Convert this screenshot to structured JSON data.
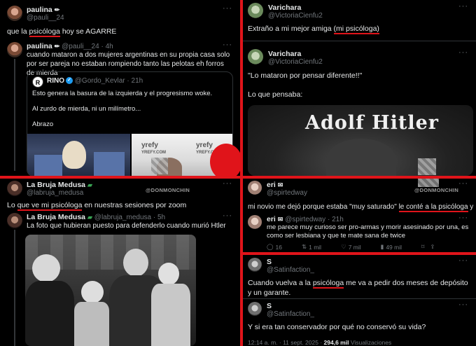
{
  "panel1": {
    "post": {
      "name": "paulina",
      "name_icon": "pencil-icon",
      "handle": "@pauli__24",
      "text_prefix": "que la ",
      "text_highlight": "psicóloga",
      "text_suffix": " hoy se AGARRE"
    },
    "reply": {
      "name": "paulina",
      "meta": "@pauli__24 · 4h",
      "text": "cuando mataron a dos mujeres argentinas en su propia casa solo por ser pareja no estaban rompiendo tanto las pelotas eh forros de mierda"
    },
    "quote": {
      "name": "RINO",
      "avatar_text": "R",
      "meta": "@Gordo_Kevlar · 21h",
      "line1": "Esto genera la basura de la izquierda y el progresismo woke.",
      "line2": "Al zurdo de mierda, ni un milímetro...",
      "line3": "Abrazo",
      "photo_text_1": "yrefy",
      "photo_text_2": "YREFY.COM",
      "photo_text_3": "yrefy",
      "photo_text_4": "YREFY.COM"
    }
  },
  "panel2": {
    "post1": {
      "name": "Varichara",
      "handle": "@VictoriaCienfu2",
      "text_prefix": "Extraño a mi mejor amiga ",
      "text_highlight": "(mi psicóloga)"
    },
    "post2": {
      "name": "Varichara",
      "handle": "@VictoriaCienfu2",
      "line1": "\"Lo mataron por pensar diferente!!\"",
      "line2": "Lo que pensaba:",
      "image_title": "Adolf Hitler"
    }
  },
  "panel3": {
    "watermark": "@DONMONCHIN",
    "post": {
      "name": "La Bruja Medusa",
      "flag_icon": "flag-icon",
      "handle": "@labruja_medusa",
      "text_prefix": "Lo ",
      "text_highlight": "que ve mi psicóloga",
      "text_suffix": " en nuestras sesiones por zoom"
    },
    "reply": {
      "name": "La Bruja Medusa",
      "meta": "@labruja_medusa · 5h",
      "text": "La foto que hubieran puesto para defenderlo cuando murió Htler"
    }
  },
  "panel4": {
    "watermark": "@DONMONCHIN",
    "post": {
      "name": "eri",
      "handle": "@spirtedway",
      "text_prefix": "mi novio me dejó porque estaba \"muy saturado\" ",
      "text_highlight": "le conté a la psicóloga",
      "text_suffix": " y"
    },
    "reply": {
      "name": "eri",
      "meta": "@spirtedway · 21h",
      "text": "me parece muy curioso ser pro-armas y morir asesinado por una, es como ser lesbiana y que te mate sana de twice",
      "replies": "16",
      "reposts": "1 mil",
      "likes": "7 mil",
      "views": "49 mil"
    }
  },
  "panel5": {
    "post": {
      "name": "S",
      "handle": "@Satinfaction_",
      "text_prefix": "Cuando vuelva a la ",
      "text_highlight": "psicóloga",
      "text_suffix": " me va a pedir dos meses de depósito y un garante."
    },
    "reply": {
      "name": "S",
      "handle": "@Satinfaction_",
      "text": "Y si era tan conservador por qué no conservó su vida?"
    },
    "footer": {
      "time": "12:14 a. m. · 11 sept. 2025 · ",
      "views": "294,6 mil",
      "views_label": " Visualizaciones"
    }
  },
  "ui": {
    "more": "···",
    "accent_red": "#e0141a",
    "verified_color": "#1d9bf0"
  }
}
